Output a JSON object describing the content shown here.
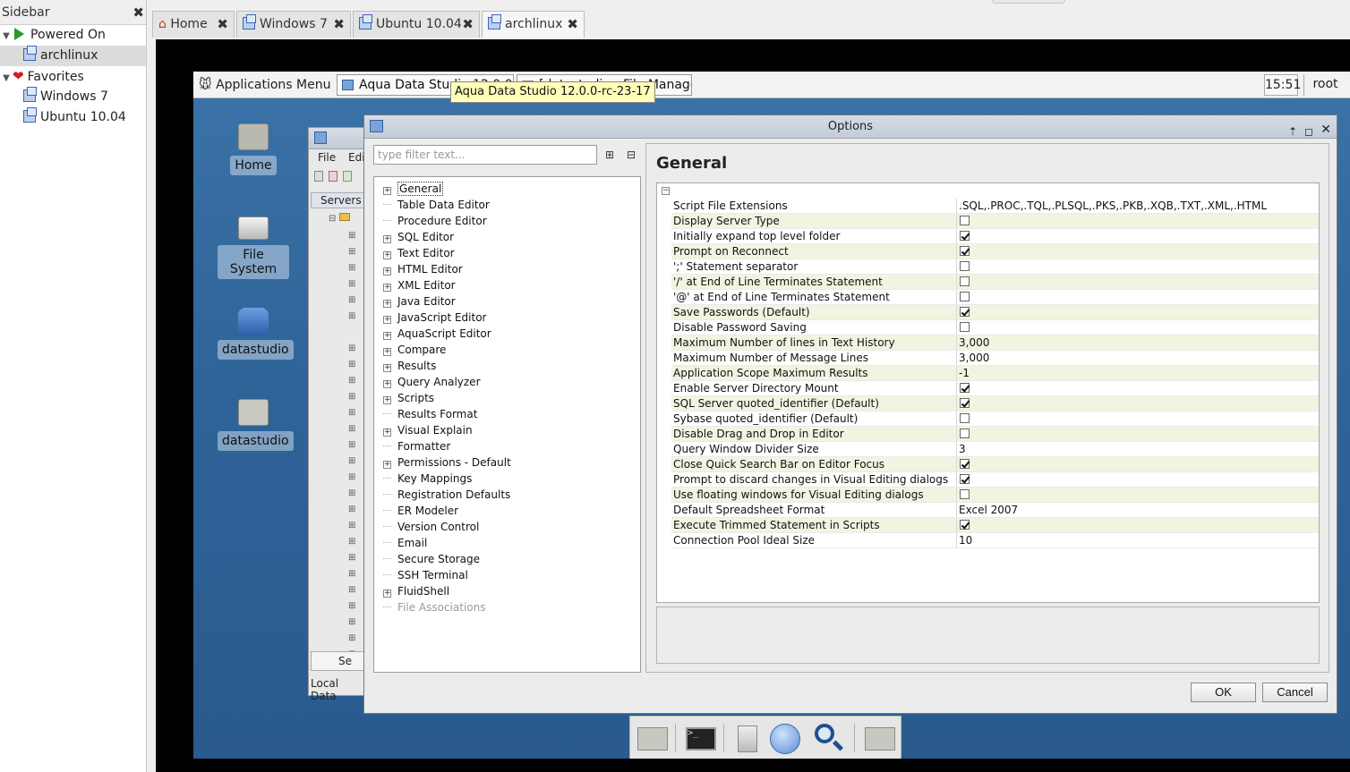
{
  "host": {
    "sidebar": {
      "title": "Sidebar",
      "close": "✖",
      "groups": [
        {
          "label": "Powered On",
          "items": [
            {
              "label": "archlinux"
            }
          ]
        },
        {
          "label": "Favorites",
          "items": [
            {
              "label": "Windows 7"
            },
            {
              "label": "Ubuntu 10.04"
            }
          ]
        }
      ]
    },
    "tabs": [
      {
        "label": "Home",
        "icon": "home-icon"
      },
      {
        "label": "Windows 7",
        "icon": "vm-icon"
      },
      {
        "label": "Ubuntu 10.04",
        "icon": "vm-icon"
      },
      {
        "label": "archlinux",
        "icon": "vm-icon"
      }
    ],
    "tab_close": "✖"
  },
  "guest": {
    "panel": {
      "apps_menu": "Applications Menu",
      "task1": "Aqua Data Studio 12.0.0",
      "task2": "[datastudio - File Manager]",
      "clock": "15:51",
      "user": "root"
    },
    "tooltip": "Aqua Data Studio 12.0.0-rc-23-17",
    "desktop_icons": [
      {
        "label": "Home"
      },
      {
        "label": "File System"
      },
      {
        "label": "datastudio"
      },
      {
        "label": "datastudio"
      }
    ],
    "back_window": {
      "menu_file": "File",
      "menu_edit": "Edi",
      "servers_tab": "Servers",
      "bottom_tab": "Se",
      "status": "Local Data"
    }
  },
  "dialog": {
    "title": "Options",
    "filter_placeholder": "type filter text...",
    "nav": [
      {
        "label": "General",
        "expandable": true,
        "selected": true
      },
      {
        "label": "Table Data Editor",
        "expandable": false
      },
      {
        "label": "Procedure Editor",
        "expandable": false
      },
      {
        "label": "SQL Editor",
        "expandable": true
      },
      {
        "label": "Text Editor",
        "expandable": true
      },
      {
        "label": "HTML Editor",
        "expandable": true
      },
      {
        "label": "XML Editor",
        "expandable": true
      },
      {
        "label": "Java Editor",
        "expandable": true
      },
      {
        "label": "JavaScript Editor",
        "expandable": true
      },
      {
        "label": "AquaScript Editor",
        "expandable": true
      },
      {
        "label": "Compare",
        "expandable": true
      },
      {
        "label": "Results",
        "expandable": true
      },
      {
        "label": "Query Analyzer",
        "expandable": true
      },
      {
        "label": "Scripts",
        "expandable": true
      },
      {
        "label": "Results Format",
        "expandable": false
      },
      {
        "label": "Visual Explain",
        "expandable": true
      },
      {
        "label": "Formatter",
        "expandable": false
      },
      {
        "label": "Permissions - Default",
        "expandable": true
      },
      {
        "label": "Key Mappings",
        "expandable": false
      },
      {
        "label": "Registration Defaults",
        "expandable": false
      },
      {
        "label": "ER Modeler",
        "expandable": false
      },
      {
        "label": "Version Control",
        "expandable": false
      },
      {
        "label": "Email",
        "expandable": false
      },
      {
        "label": "Secure Storage",
        "expandable": false
      },
      {
        "label": "SSH Terminal",
        "expandable": false
      },
      {
        "label": "FluidShell",
        "expandable": true
      },
      {
        "label": "File Associations",
        "expandable": false,
        "disabled": true
      }
    ],
    "section_title": "General",
    "properties": [
      {
        "name": "Script File Extensions",
        "type": "text",
        "value": ".SQL,.PROC,.TQL,.PLSQL,.PKS,.PKB,.XQB,.TXT,.XML,.HTML"
      },
      {
        "name": "Display Server Type",
        "type": "bool",
        "checked": false
      },
      {
        "name": "Initially expand top level folder",
        "type": "bool",
        "checked": true
      },
      {
        "name": "Prompt on Reconnect",
        "type": "bool",
        "checked": true
      },
      {
        "name": "';' Statement separator",
        "type": "bool",
        "checked": false
      },
      {
        "name": "'/' at End of Line Terminates Statement",
        "type": "bool",
        "checked": false
      },
      {
        "name": "'@' at End of Line Terminates Statement",
        "type": "bool",
        "checked": false
      },
      {
        "name": "Save Passwords (Default)",
        "type": "bool",
        "checked": true
      },
      {
        "name": "Disable Password Saving",
        "type": "bool",
        "checked": false
      },
      {
        "name": "Maximum Number of lines in Text History",
        "type": "text",
        "value": "3,000"
      },
      {
        "name": "Maximum Number of Message Lines",
        "type": "text",
        "value": "3,000"
      },
      {
        "name": "Application Scope Maximum Results",
        "type": "text",
        "value": "-1"
      },
      {
        "name": "Enable Server Directory Mount",
        "type": "bool",
        "checked": true
      },
      {
        "name": "SQL Server quoted_identifier (Default)",
        "type": "bool",
        "checked": true
      },
      {
        "name": "Sybase quoted_identifier (Default)",
        "type": "bool",
        "checked": false
      },
      {
        "name": "Disable Drag and Drop in Editor",
        "type": "bool",
        "checked": false
      },
      {
        "name": "Query Window Divider Size",
        "type": "text",
        "value": "3"
      },
      {
        "name": "Close Quick Search Bar on Editor Focus",
        "type": "bool",
        "checked": true
      },
      {
        "name": "Prompt to discard changes in Visual Editing dialogs",
        "type": "bool",
        "checked": true
      },
      {
        "name": "Use floating windows for Visual Editing dialogs",
        "type": "bool",
        "checked": false
      },
      {
        "name": "Default Spreadsheet Format",
        "type": "text",
        "value": "Excel 2007"
      },
      {
        "name": "Execute Trimmed Statement in Scripts",
        "type": "bool",
        "checked": true
      },
      {
        "name": "Connection Pool Ideal Size",
        "type": "text",
        "value": "10"
      }
    ],
    "ok_label": "OK",
    "cancel_label": "Cancel"
  },
  "colors": {
    "desktop": "#2f6498",
    "row_alt": "#f3f3e2",
    "tooltip": "#ffffb8"
  }
}
